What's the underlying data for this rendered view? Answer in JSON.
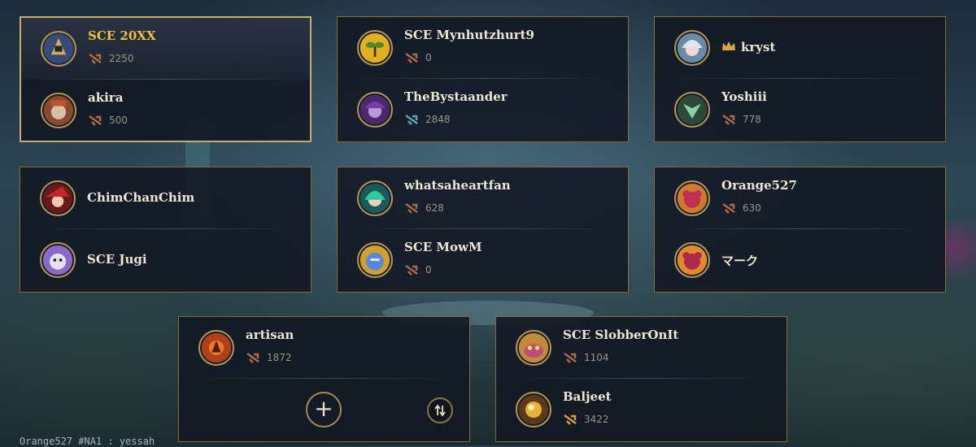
{
  "colors": {
    "gold_border": "#c9ac6d",
    "card_border": "#8a6a36",
    "card_bg": "#121824",
    "name_text": "#ece5d3",
    "highlight_name": "#f0c040"
  },
  "lobby": {
    "cards": [
      {
        "players": [
          {
            "name": "SCE 20XX",
            "stat": "2250",
            "rank_icon": "bronze-rank-icon",
            "avatar_icon": "armored-knight-avatar"
          },
          {
            "name": "akira",
            "stat": "500",
            "rank_icon": "bronze-rank-icon",
            "avatar_icon": "shaman-avatar"
          }
        ]
      },
      {
        "players": [
          {
            "name": "SCE Mynhutzhurt9",
            "stat": "0",
            "rank_icon": "bronze-rank-icon",
            "avatar_icon": "sprout-avatar"
          },
          {
            "name": "TheBystaander",
            "stat": "2848",
            "rank_icon": "platinum-rank-icon",
            "avatar_icon": "purple-hair-avatar"
          }
        ]
      },
      {
        "players": [
          {
            "name": "kryst",
            "crown_icon": "crown-icon",
            "avatar_icon": "silver-hair-avatar"
          },
          {
            "name": "Yoshiii",
            "stat": "778",
            "rank_icon": "bronze-rank-icon",
            "avatar_icon": "jade-spirit-avatar"
          }
        ]
      },
      {
        "players": [
          {
            "name": "ChimChanChim",
            "avatar_icon": "red-hat-avatar"
          },
          {
            "name": "SCE Jugi",
            "avatar_icon": "purple-creature-avatar"
          }
        ]
      },
      {
        "players": [
          {
            "name": "whatsaheartfan",
            "stat": "628",
            "rank_icon": "bronze-rank-icon",
            "avatar_icon": "green-hair-avatar"
          },
          {
            "name": "SCE MowM",
            "stat": "0",
            "rank_icon": "bronze-rank-icon",
            "avatar_icon": "blue-golem-avatar"
          }
        ]
      },
      {
        "players": [
          {
            "name": "Orange527",
            "stat": "630",
            "rank_icon": "bronze-rank-icon",
            "avatar_icon": "pink-beast-avatar"
          },
          {
            "name": "マーク",
            "avatar_icon": "pink-beast-avatar-alt"
          }
        ]
      },
      {
        "players": [
          {
            "name": "artisan",
            "stat": "1872",
            "rank_icon": "bronze-rank-icon",
            "avatar_icon": "fire-crest-avatar"
          }
        ],
        "add_button": "+",
        "swap_icon": "swap-arrows-icon"
      },
      {
        "players": [
          {
            "name": "SCE SlobberOnIt",
            "stat": "1104",
            "rank_icon": "bronze-rank-icon",
            "avatar_icon": "slug-avatar"
          },
          {
            "name": "Baljeet",
            "stat": "3422",
            "rank_icon": "gold-rank-icon",
            "avatar_icon": "golden-orb-avatar"
          }
        ]
      }
    ]
  },
  "footer": {
    "text": "Orange527 #NA1 : yessah"
  }
}
